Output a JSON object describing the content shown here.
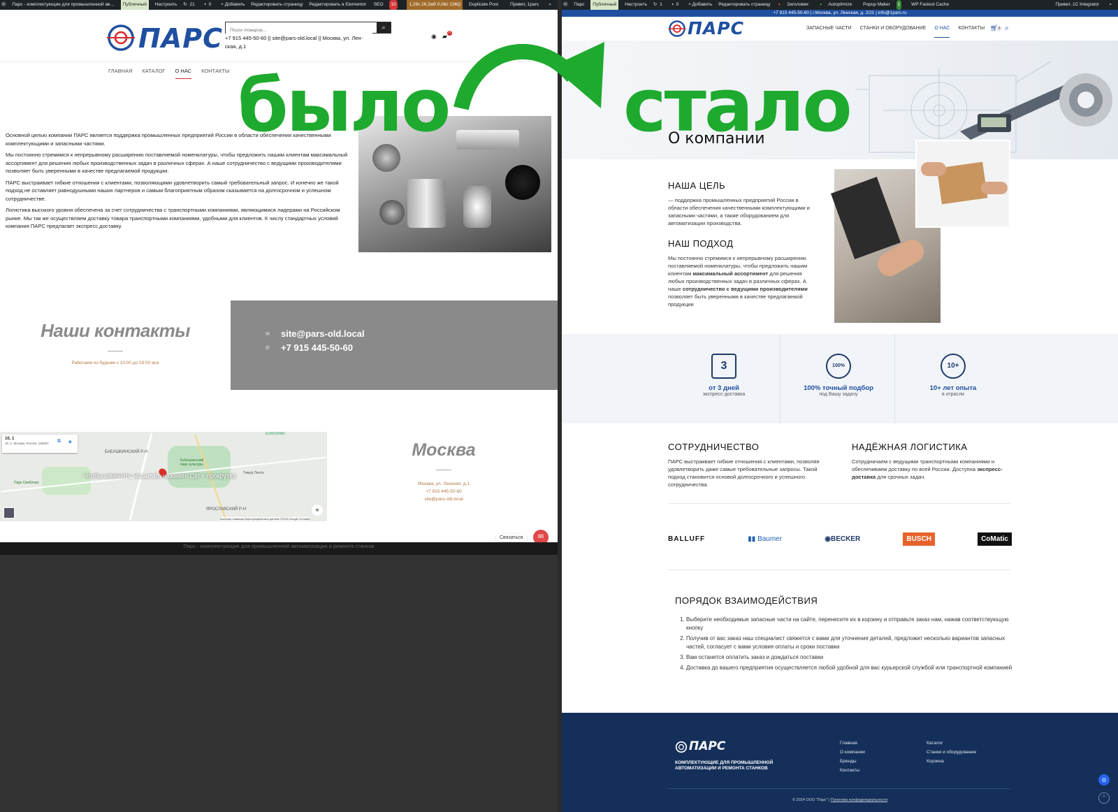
{
  "left": {
    "wpbar": {
      "items": [
        "Парс - комплектующие для промышленной ав…",
        "Публичный",
        "Настроить",
        "21",
        "0",
        "+ Добавить",
        "Редактировать страницу",
        "Редактировать в Elementor",
        "SEO",
        "10",
        "1,29с  26,2мб  0,06с  136Q",
        "Duplicate Post",
        "Привет, 1pars"
      ]
    },
    "header": {
      "logo": "ПАРС",
      "search_placeholder": "Поиск товаров...",
      "contacts": "+7 915 445-50-60 || site@pars-old.local || Москва, ул. Ленская, д.1",
      "contacts_line1": "+7 915 445-50-60 || site@pars-old.local || Москва, ул. Лен-",
      "contacts_line2": "ская, д.1",
      "cart_count": "0"
    },
    "nav": [
      "ГЛАВНАЯ",
      "КАТАЛОГ",
      "О НАС",
      "КОНТАКТЫ"
    ],
    "about_paragraphs": [
      "Основной целью компании ПАРС является поддержка промышленных предприятий России в области обеспечения качественными комплектующими и запасными частями.",
      "Мы постоянно стремимся к непрерывному расширению поставляемой номенклатуры, чтобы предложить нашим клиентам максимальный ассортимент для решения любых производственных задач в различных сферах. А наше сотрудничество с ведущими производителями позволяет быть уверенными в качестве предлагаемой продукции.",
      "ПАРС выстраивает гибкие отношения с клиентами, позволяющими удовлетворить самый требовательный запрос. И конечно же такой подход не оставляет равнодушными наших партнеров и самым благоприятным образом сказывается на долгосрочном и успешном сотрудничестве.",
      "Логистика высокого уровня обеспечена за счет сотрудничества с транспортными компаниями, являющимися лидерами на Российском рынке. Мы так же осуществляем доставку товара транспортными компаниями, удобными для клиентов. К числу стандартных условий компания ПАРС предлагает экспресс доставку."
    ],
    "contacts_block": {
      "title": "Наши контакты",
      "hours": "Работаем по будням с 10:00 до 19:00 мск",
      "email": "site@pars-old.local",
      "phone": "+7 915 445-50-60"
    },
    "map": {
      "card_title": "10, 1",
      "card_address": "10, 1, Москва, Россия, 129327",
      "hint": "Чтобы изменить масштаб, нажмите Ctrl + прокрутка",
      "labels": [
        "БАБУШКИНСКИЙ Р-Н",
        "ЯРОСЛАВСКИЙ Р-Н",
        "Бабушкинский парк культуры",
        "Тимур Лента",
        "EUROSPAR",
        "Парк Свиблово"
      ],
      "attribution": "Быстрые клавиши   Картографические данные ©2025 Google   Условия"
    },
    "city_block": {
      "title": "Москва",
      "address": "Москва, ул. Ленская, д.1",
      "phone": "+7 915 445-50-60",
      "email": "site@pars-old.local"
    },
    "chat_label": "Связаться",
    "footer_text": "Парс - комплектующие для промышленной автоматизации и ремонта станков"
  },
  "overlay": {
    "before": "было",
    "after": "стало",
    "arrow_color": "#1eaa2e"
  },
  "right": {
    "wpbar": {
      "items": [
        "Парс",
        "Публичный",
        "Настроить",
        "1",
        "0",
        "+ Добавить",
        "Редактировать страницу",
        "Заголовки",
        "Autoptimize",
        "Popup Maker",
        "WP Fastest Cache",
        "Привет, 1C Integrator"
      ]
    },
    "topline": "+7 915 445-50-60 | г.Москва, ул. Ленская, д. 2/21 | info@1pars.ru",
    "header": {
      "logo": "ПАРС",
      "nav": [
        "ЗАПАСНЫЕ ЧАСТИ",
        "СТАНКИ И ОБОРУДОВАНИЕ",
        "О НАС",
        "КОНТАКТЫ"
      ],
      "cart_count": "0"
    },
    "hero_title": "О компании",
    "goal": {
      "title": "НАША ЦЕЛЬ",
      "text": "— поддержка промышленных предприятий России в области обеспечения качественными комплектующими и запасными частями, а также оборудованием для автоматизации производства."
    },
    "approach": {
      "title": "НАШ ПОДХОД",
      "text_a": "Мы постоянно стремимся к непрерывному расширению поставляемой номенклатуры, чтобы предложить нашим клиентам ",
      "bold_a": "максимальный ассортимент",
      "text_b": " для решения любых производственных задач в различных сферах. А наше ",
      "bold_b": "сотрудничество с ведущими производителями",
      "text_c": " позволяет быть уверенными в качестве предлагаемой продукции"
    },
    "stats": [
      {
        "title": "от 3 дней",
        "sub": "экспресс-доставка",
        "icon": "3"
      },
      {
        "title": "100% точный подбор",
        "sub": "под Вашу задачу",
        "icon": "100%"
      },
      {
        "title": "10+ лет опыта",
        "sub": "в отрасли",
        "icon": "10+"
      }
    ],
    "cooperation": {
      "title": "СОТРУДНИЧЕСТВО",
      "text": "ПАРС выстраивает гибкие отношения с клиентами, позволяя удовлетворить даже самые требовательные запросы. Такой подход становится основой долгосрочного и успешного сотрудничества."
    },
    "logistics": {
      "title": "НАДЁЖНАЯ ЛОГИСТИКА",
      "text_a": "Сотрудничаем с ведущими транспортными компаниями и обеспечиваем доставку по всей России. Доступна ",
      "bold": "экспресс-доставка",
      "text_b": " для срочных задач."
    },
    "brands": [
      "BALLUFF",
      "Baumer",
      "BECKER",
      "BUSCH",
      "CoMatic"
    ],
    "process": {
      "title": "ПОРЯДОК ВЗАИМОДЕЙСТВИЯ",
      "steps": [
        "Выберите необходимые запасные части на сайте, перенесите их в корзину и отправьте заказ нам, нажав соответствующую кнопку",
        "Получив от вас заказ наш специалист свяжется с вами для уточнения деталей, предложит несколько вариантов запасных частей, согласует с вами условия оплаты и сроки поставки",
        "Вам останется оплатить заказ и дождаться поставки",
        "Доставка до вашего предприятия осуществляется любой удобной для вас курьерской службой или транспортной компанией"
      ]
    },
    "footer": {
      "logo": "ПАРС",
      "tagline": "КОМПЛЕКТУЮЩИЕ ДЛЯ ПРОМЫШЛЕННОЙ АВТОМАТИЗАЦИИ И РЕМОНТА СТАНКОВ",
      "col1": [
        "Главная",
        "О компании",
        "Бренды",
        "Контакты"
      ],
      "col2": [
        "Каталог",
        "Станки и оборудование",
        "Корзина"
      ],
      "copyright": "© 2024 ООО \"Парс\" | ",
      "policy": "Политика конфиденциальности"
    },
    "colors": {
      "navy": "#14305a",
      "accent": "#1f4fa0"
    }
  }
}
